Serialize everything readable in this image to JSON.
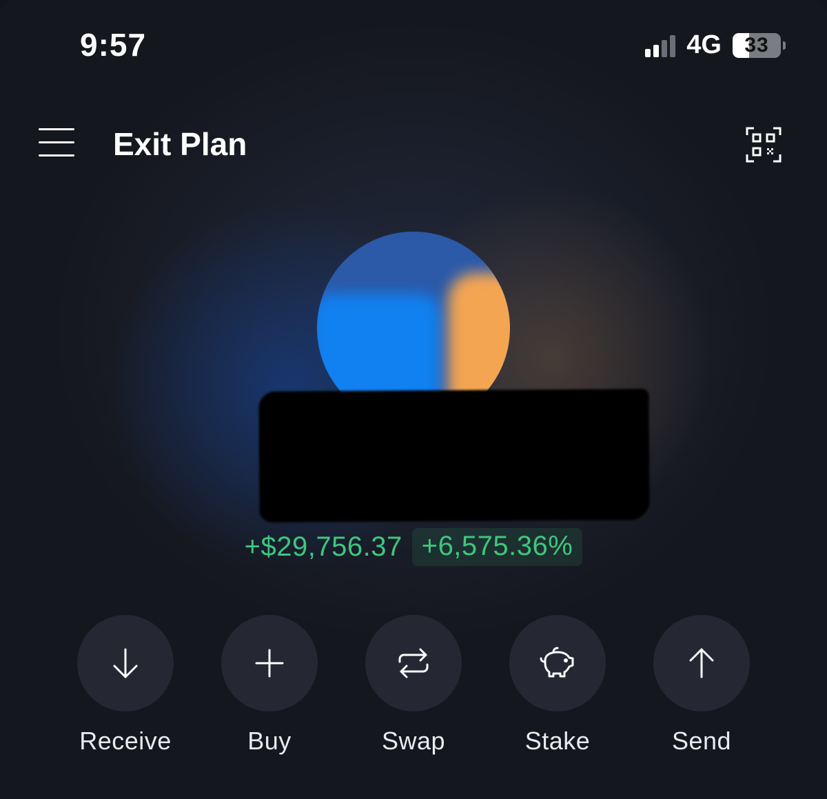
{
  "status_bar": {
    "time": "9:57",
    "network": "4G",
    "battery_level": "33",
    "signal_bars": 2,
    "signal_bars_total": 4
  },
  "header": {
    "title": "Exit Plan",
    "menu_icon": "hamburger-menu-icon",
    "qr_icon": "qr-scan-icon"
  },
  "portfolio": {
    "avatar_colors": [
      "#2a58a8",
      "#1180f0",
      "#f4a552"
    ],
    "gain_amount": "+$29,756.37",
    "gain_percent": "+6,575.36%",
    "gain_color": "#3ec77d"
  },
  "actions": [
    {
      "label": "Receive",
      "icon": "arrow-down-icon"
    },
    {
      "label": "Buy",
      "icon": "plus-icon"
    },
    {
      "label": "Swap",
      "icon": "swap-icon"
    },
    {
      "label": "Stake",
      "icon": "piggy-bank-icon"
    },
    {
      "label": "Send",
      "icon": "arrow-up-icon"
    }
  ]
}
